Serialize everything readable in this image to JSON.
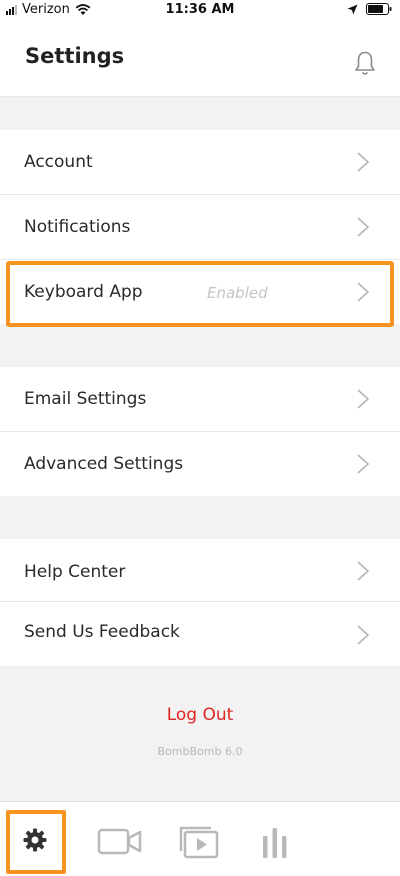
{
  "status_bar": {
    "carrier": "Verizon",
    "time": "11:36 AM"
  },
  "header": {
    "title": "Settings",
    "bell_icon": "bell-icon"
  },
  "groups": [
    {
      "items": [
        {
          "label": "Account"
        },
        {
          "label": "Notifications"
        },
        {
          "label": "Keyboard App",
          "status": "Enabled"
        }
      ]
    },
    {
      "items": [
        {
          "label": "Email Settings"
        },
        {
          "label": "Advanced Settings"
        }
      ]
    },
    {
      "items": [
        {
          "label": "Help Center"
        },
        {
          "label": "Send Us Feedback"
        }
      ]
    }
  ],
  "footer": {
    "logout_label": "Log Out",
    "version": "BombBomb 6.0"
  },
  "tabbar": {
    "tabs": [
      {
        "icon": "gear-icon",
        "active": true
      },
      {
        "icon": "video-camera-icon",
        "active": false
      },
      {
        "icon": "video-library-icon",
        "active": false
      },
      {
        "icon": "bar-chart-icon",
        "active": false
      }
    ]
  },
  "colors": {
    "accent_highlight": "#f7931e",
    "logout": "#e02424",
    "background": "#f2f2f2"
  }
}
